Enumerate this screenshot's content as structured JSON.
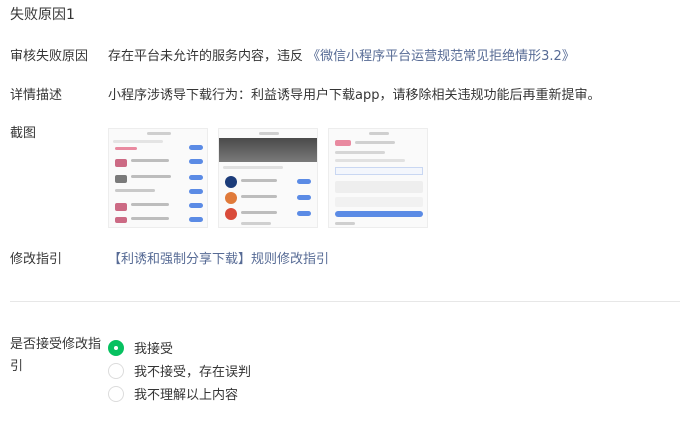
{
  "section_title": "失败原因1",
  "reject_reason": {
    "label": "审核失败原因",
    "text": "存在平台未允许的服务内容，违反",
    "link": "《微信小程序平台运营规范常见拒绝情形3.2》"
  },
  "detail": {
    "label": "详情描述",
    "text": "小程序涉诱导下载行为：利益诱导用户下载app，请移除相关违规功能后再重新提审。"
  },
  "screenshot": {
    "label": "截图",
    "images": [
      "screenshot-list",
      "screenshot-dark-banner",
      "screenshot-form"
    ]
  },
  "guide": {
    "label": "修改指引",
    "link": "【利诱和强制分享下载】规则修改指引"
  },
  "accept": {
    "label": "是否接受修改指引",
    "options": [
      {
        "label": "我接受",
        "checked": true
      },
      {
        "label": "我不接受，存在误判",
        "checked": false
      },
      {
        "label": "我不理解以上内容",
        "checked": false
      }
    ]
  },
  "colors": {
    "link": "#576b95",
    "radio_checked": "#07c160",
    "divider": "#e7e7e7"
  }
}
